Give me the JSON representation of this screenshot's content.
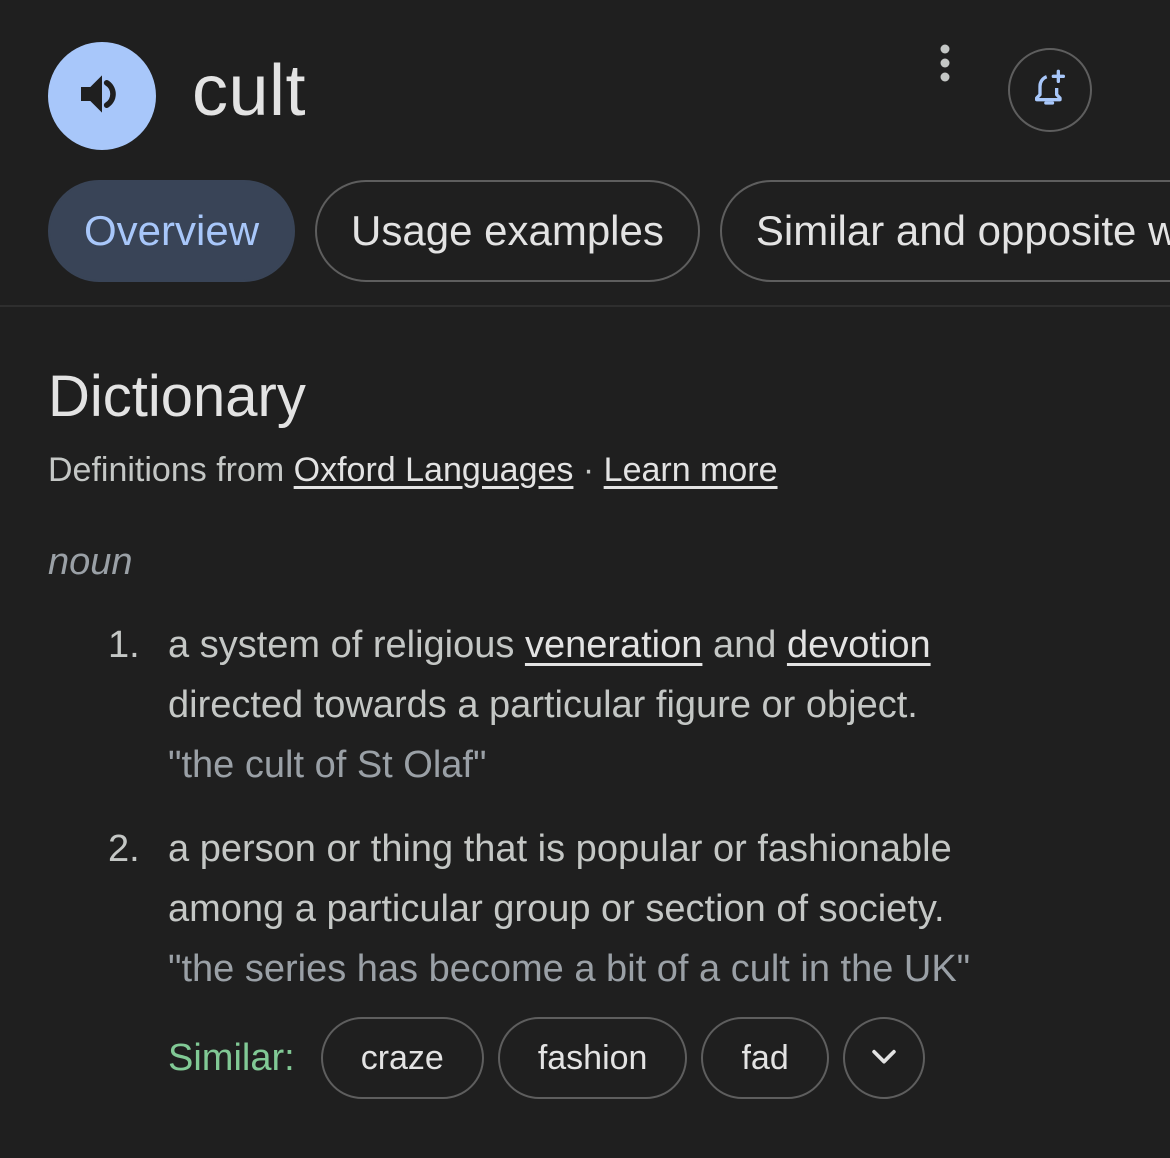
{
  "header": {
    "word": "cult",
    "speaker_icon": "volume-up-icon",
    "more_icon": "more-vert-icon",
    "alert_icon": "add-alert-icon"
  },
  "tabs": [
    {
      "label": "Overview",
      "active": true
    },
    {
      "label": "Usage examples",
      "active": false
    },
    {
      "label": "Similar and opposite words",
      "active": false
    }
  ],
  "dictionary": {
    "title": "Dictionary",
    "source_prefix": "Definitions from",
    "source_link": "Oxford Languages",
    "separator": "·",
    "learn_more": "Learn more",
    "part_of_speech": "noun",
    "senses": [
      {
        "number": "1.",
        "text_a": "a system of religious",
        "link_a": "veneration",
        "text_b": "and",
        "link_b": "devotion",
        "line2": "directed towards a particular figure or object.",
        "example": "\"the cult of St Olaf\""
      },
      {
        "number": "2.",
        "line1": "a person or thing that is popular or fashionable",
        "line2": "among a particular group or section of society.",
        "example": "\"the series has become a bit of a cult in the UK\""
      }
    ],
    "similar": {
      "label": "Similar:",
      "chips": [
        "craze",
        "fashion",
        "fad"
      ],
      "expand_icon": "chevron-down-icon"
    }
  },
  "colors": {
    "background": "#1f1f1f",
    "accent": "#a8c7fa",
    "active_tab_bg": "#394457",
    "similar_label": "#81c995"
  }
}
